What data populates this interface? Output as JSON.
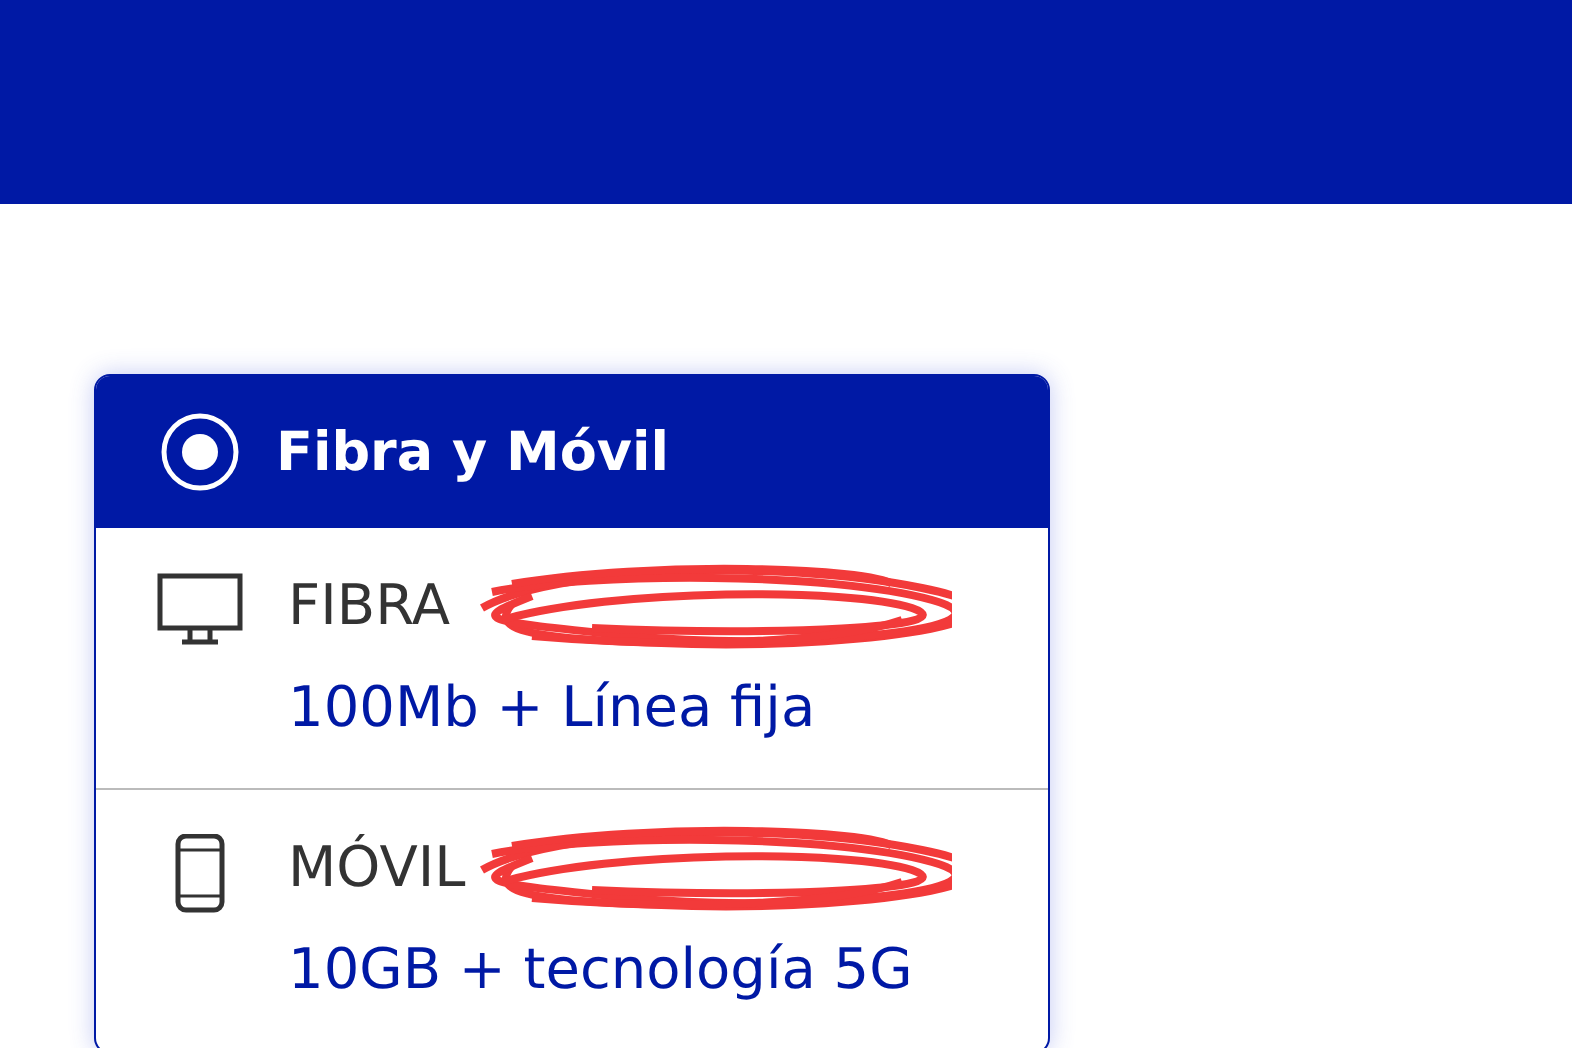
{
  "plan": {
    "title": "Fibra y Móvil",
    "selected": true
  },
  "items": [
    {
      "kind": "fiber",
      "name": "FIBRA",
      "redacted": true,
      "detail": "100Mb + Línea fija"
    },
    {
      "kind": "mobile",
      "name": "MÓVIL",
      "redacted": true,
      "detail": "10GB + tecnología 5G"
    }
  ]
}
